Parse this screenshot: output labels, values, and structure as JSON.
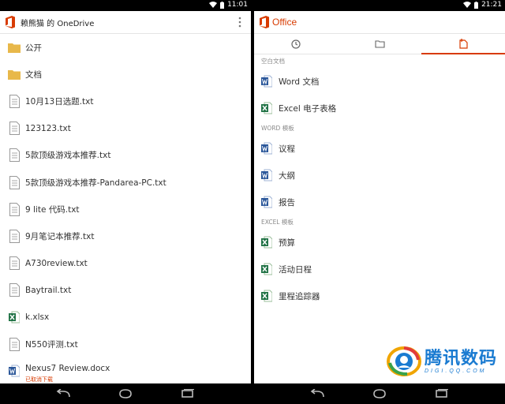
{
  "left": {
    "status_time": "11:01",
    "title": "赖熊猫 的 OneDrive",
    "files": [
      {
        "name": "公开",
        "icon": "folder-icon"
      },
      {
        "name": "文档",
        "icon": "folder-icon"
      },
      {
        "name": "10月13日选题.txt",
        "icon": "text-file-icon"
      },
      {
        "name": "123123.txt",
        "icon": "text-file-icon"
      },
      {
        "name": "5款顶级游戏本推荐.txt",
        "icon": "text-file-icon"
      },
      {
        "name": "5款顶级游戏本推荐-Pandarea-PC.txt",
        "icon": "text-file-icon"
      },
      {
        "name": "9 lite 代码.txt",
        "icon": "text-file-icon"
      },
      {
        "name": "9月笔记本推荐.txt",
        "icon": "text-file-icon"
      },
      {
        "name": "A730review.txt",
        "icon": "text-file-icon"
      },
      {
        "name": "Baytrail.txt",
        "icon": "text-file-icon"
      },
      {
        "name": "k.xlsx",
        "icon": "excel-file-icon"
      },
      {
        "name": "N550评测.txt",
        "icon": "text-file-icon"
      },
      {
        "name": "Nexus7  Review.docx",
        "icon": "word-file-icon",
        "sub": "已取消下载"
      }
    ]
  },
  "right": {
    "status_time": "21:21",
    "brand": "Office",
    "tabs": [
      {
        "name": "recent-tab",
        "icon": "clock-icon"
      },
      {
        "name": "open-tab",
        "icon": "folder-icon"
      },
      {
        "name": "new-tab",
        "icon": "new-document-icon",
        "active": true
      }
    ],
    "sections": [
      {
        "header": "空白文档",
        "items": [
          {
            "label": "Word 文档",
            "icon": "word-doc-icon"
          },
          {
            "label": "Excel 电子表格",
            "icon": "excel-doc-icon"
          }
        ]
      },
      {
        "header": "WORD 模板",
        "items": [
          {
            "label": "议程",
            "icon": "word-doc-icon"
          },
          {
            "label": "大纲",
            "icon": "word-doc-icon"
          },
          {
            "label": "报告",
            "icon": "word-doc-icon"
          }
        ]
      },
      {
        "header": "EXCEL 模板",
        "items": [
          {
            "label": "预算",
            "icon": "excel-doc-icon"
          },
          {
            "label": "活动日程",
            "icon": "excel-doc-icon"
          },
          {
            "label": "里程追踪器",
            "icon": "excel-doc-icon"
          }
        ]
      }
    ]
  },
  "watermark": {
    "title": "腾讯数码",
    "sub": "DIGI.QQ.COM"
  },
  "colors": {
    "office_orange": "#d83b01",
    "word_blue": "#2b579a",
    "excel_green": "#217346",
    "folder_yellow": "#e8b84a"
  }
}
